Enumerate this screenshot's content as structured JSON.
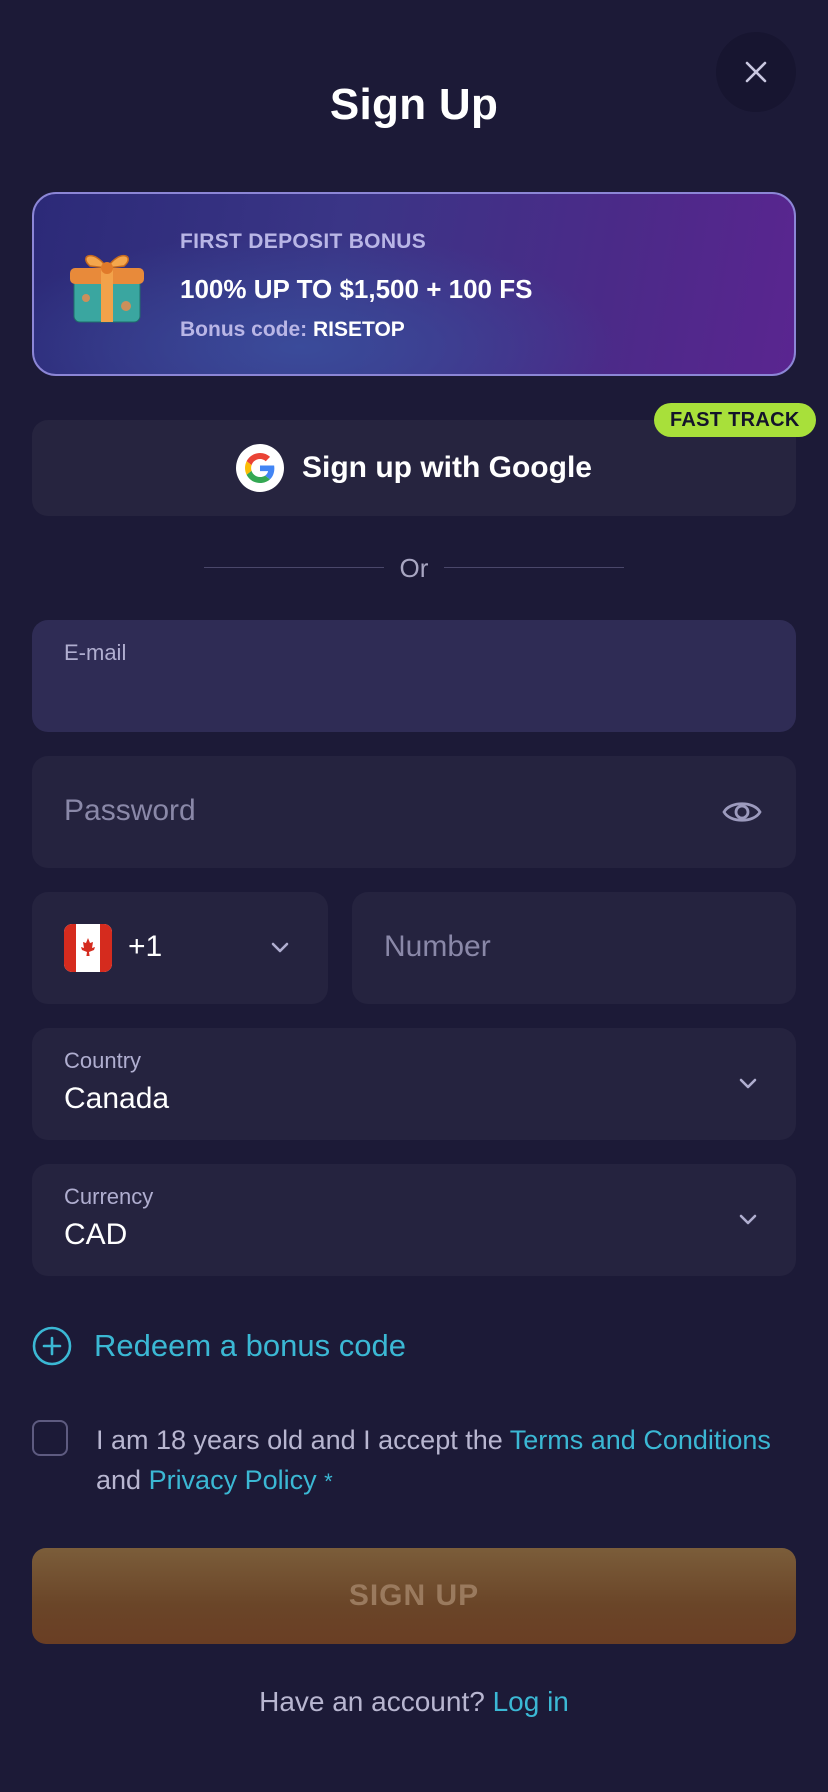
{
  "page": {
    "title": "Sign Up"
  },
  "bonus": {
    "kicker": "FIRST DEPOSIT BONUS",
    "amount": "100% UP TO $1,500 + 100 FS",
    "code_label": "Bonus code:",
    "code": "RISETOP"
  },
  "google": {
    "label": "Sign up with Google",
    "badge": "FAST TRACK"
  },
  "divider": {
    "text": "Or"
  },
  "form": {
    "email": {
      "label": "E-mail",
      "value": ""
    },
    "password": {
      "placeholder": "Password"
    },
    "phone": {
      "country_code": "+1",
      "placeholder": "Number",
      "flag": "canada-flag"
    },
    "country": {
      "label": "Country",
      "value": "Canada"
    },
    "currency": {
      "label": "Currency",
      "value": "CAD"
    }
  },
  "redeem": {
    "label": "Redeem a bonus code"
  },
  "consent": {
    "text_before": "I am 18 years old and I accept the ",
    "terms_link": "Terms and Conditions",
    "text_middle": "and ",
    "privacy_link": "Privacy Policy",
    "required_mark": "*"
  },
  "submit": {
    "label": "SIGN UP"
  },
  "footer": {
    "prompt": "Have an account? ",
    "login_link": "Log in"
  },
  "colors": {
    "background": "#1c1a37",
    "field": "#25233f",
    "accent_link": "#3bb8d4",
    "fast_track_badge": "#a8e03a",
    "signup_button": "#6a4528"
  }
}
